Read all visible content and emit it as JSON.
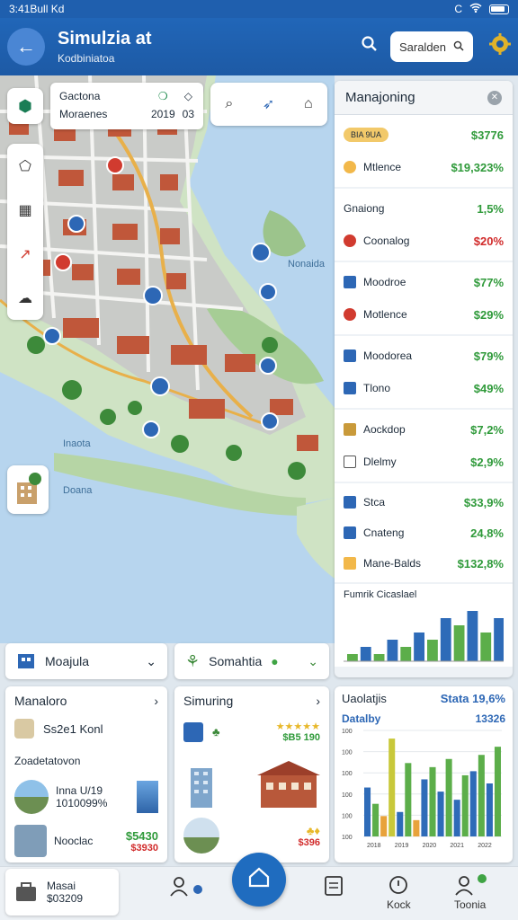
{
  "status": {
    "time": "3:41Bull Kd",
    "carrier": "C"
  },
  "header": {
    "title": "Simulzia at",
    "subtitle": "Kodbiniatoa",
    "search_placeholder": "Saralden"
  },
  "map": {
    "info": {
      "name1": "Gactona",
      "name2": "Moraenes",
      "v1": "2019",
      "v2": "03"
    },
    "labels": {
      "water1": "Nonaida",
      "water2": "Inaota",
      "water3": "Doana"
    }
  },
  "panel": {
    "title": "Manajoning",
    "rows": [
      {
        "label": "BIA 9UA",
        "value": "$3776",
        "color": "g"
      },
      {
        "label": "Mtlence",
        "value": "$19,323%",
        "color": "g"
      },
      {
        "label": "Gnaiong",
        "value": "1,5%",
        "color": "g"
      },
      {
        "label": "Coonalog",
        "value": "$20%",
        "color": "r"
      },
      {
        "label": "Moodroe",
        "value": "$77%",
        "color": "g"
      },
      {
        "label": "Motlence",
        "value": "$29%",
        "color": "g"
      },
      {
        "label": "Moodorea",
        "value": "$79%",
        "color": "g"
      },
      {
        "label": "Tlono",
        "value": "$49%",
        "color": "g"
      },
      {
        "label": "Aockdop",
        "value": "$7,2%",
        "color": "g"
      },
      {
        "label": "Dlelmy",
        "value": "$2,9%",
        "color": "g"
      },
      {
        "label": "Stca",
        "value": "$33,9%",
        "color": "g"
      },
      {
        "label": "Cnateng",
        "value": "24,8%",
        "color": "g"
      },
      {
        "label": "Mane-Balds",
        "value": "$132,8%",
        "color": "g"
      }
    ],
    "mini_chart_label": "Fumrik Cicaslael"
  },
  "dropdowns": {
    "left": "Moajula",
    "right": "Somahtia"
  },
  "card_left": {
    "title": "Manaloro",
    "person": "Ss2e1 Konl",
    "section": "Zoadetatovon",
    "item1_name": "Inna U/19",
    "item1_val": "1010099%",
    "item2_name": "Nooclac",
    "item2_price": "$5430",
    "item2_price2": "$3930"
  },
  "card_mid": {
    "title": "Simuring",
    "price": "$B5 190",
    "price2": "$396"
  },
  "chart": {
    "title": "Uaolatjis",
    "stat_label": "Stata 19,6%",
    "sub_label": "Datalby",
    "sub_value": "13326"
  },
  "chart_data": [
    {
      "type": "bar",
      "series": [
        {
          "values": [
            1,
            2,
            1,
            3,
            2,
            4,
            3,
            6,
            5,
            7,
            4,
            6
          ]
        }
      ]
    },
    {
      "type": "bar",
      "categories": [
        "2018",
        "2019",
        "2020",
        "2021",
        "2022"
      ],
      "y_ticks": [
        "100",
        "100",
        "100",
        "100",
        "100",
        "100"
      ],
      "series": [
        {
          "color": "#2e6bb8",
          "values": [
            60,
            30,
            70,
            55,
            45,
            80,
            65
          ]
        },
        {
          "color": "#5cae4a",
          "values": [
            40,
            90,
            85,
            95,
            75,
            100,
            110
          ]
        },
        {
          "color": "#e8a23b",
          "values": [
            25,
            20
          ]
        },
        {
          "color": "#c8c83a",
          "values": [
            120
          ]
        }
      ]
    }
  ],
  "profile": {
    "name": "Masai",
    "value": "$03209"
  },
  "nav": {
    "item_kock": "Kock",
    "item_team": "Toonia"
  }
}
